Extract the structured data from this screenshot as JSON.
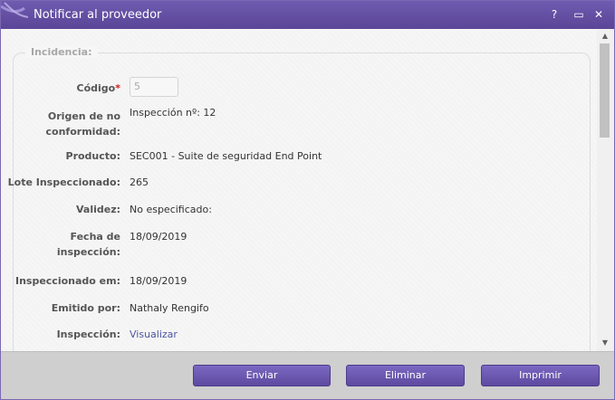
{
  "window": {
    "title": "Notificar al proveedor",
    "help_label": "?",
    "maximize_label": "▭",
    "close_label": "✕"
  },
  "form": {
    "legend": "Incidencia:",
    "fields": [
      {
        "label": "Código",
        "required_mark": "*",
        "value": "5"
      },
      {
        "label_line1": "Origen de no",
        "label_line2": "conformidad:",
        "value": "Inspección nº: 12"
      },
      {
        "label": "Producto:",
        "value": "SEC001 - Suite de seguridad End Point"
      },
      {
        "label": "Lote Inspeccionado:",
        "value": "265"
      },
      {
        "label": "Validez:",
        "value": "No especificado:"
      },
      {
        "label_line1": "Fecha de",
        "label_line2": "inspección:",
        "value": "18/09/2019"
      },
      {
        "label": "Inspeccionado em:",
        "value": "18/09/2019"
      },
      {
        "label": "Emitido por:",
        "value": "Nathaly Rengifo"
      },
      {
        "label": "Inspección:",
        "value": "Visualizar"
      }
    ]
  },
  "footer": {
    "send_label": "Enviar",
    "delete_label": "Eliminar",
    "print_label": "Imprimir"
  },
  "colors": {
    "accent": "#6a55ad",
    "required": "#cc1f1f",
    "link": "#4b55a0"
  }
}
